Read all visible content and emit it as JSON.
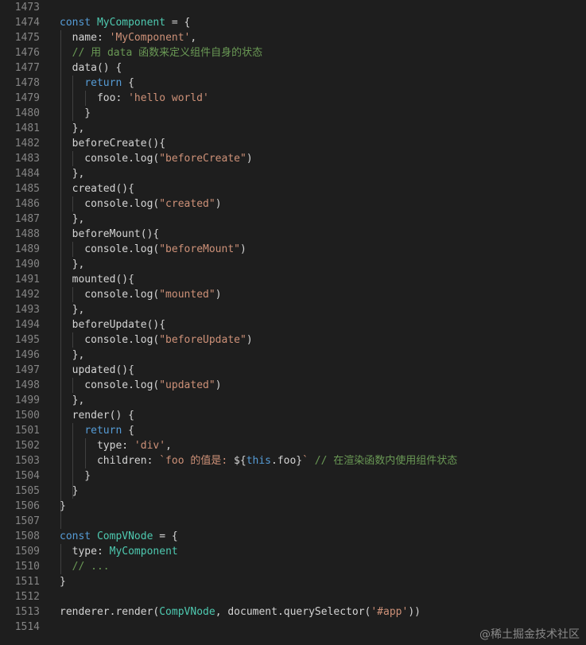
{
  "lines": [
    {
      "num": "1473",
      "segs": []
    },
    {
      "num": "1474",
      "segs": [
        {
          "t": "const ",
          "c": "kw"
        },
        {
          "t": "MyComponent",
          "c": "cls"
        },
        {
          "t": " = {",
          "c": ""
        }
      ]
    },
    {
      "num": "1475",
      "segs": [
        {
          "t": "  name: ",
          "c": ""
        },
        {
          "t": "'MyComponent'",
          "c": "str"
        },
        {
          "t": ",",
          "c": ""
        }
      ]
    },
    {
      "num": "1476",
      "segs": [
        {
          "t": "  // 用 data 函数来定义组件自身的状态",
          "c": "cm"
        }
      ]
    },
    {
      "num": "1477",
      "segs": [
        {
          "t": "  data() {",
          "c": ""
        }
      ]
    },
    {
      "num": "1478",
      "segs": [
        {
          "t": "    ",
          "c": ""
        },
        {
          "t": "return",
          "c": "kw"
        },
        {
          "t": " {",
          "c": ""
        }
      ]
    },
    {
      "num": "1479",
      "segs": [
        {
          "t": "      foo: ",
          "c": ""
        },
        {
          "t": "'hello world'",
          "c": "str"
        }
      ]
    },
    {
      "num": "1480",
      "segs": [
        {
          "t": "    }",
          "c": ""
        }
      ]
    },
    {
      "num": "1481",
      "segs": [
        {
          "t": "  },",
          "c": ""
        }
      ]
    },
    {
      "num": "1482",
      "segs": [
        {
          "t": "  beforeCreate(){",
          "c": ""
        }
      ]
    },
    {
      "num": "1483",
      "segs": [
        {
          "t": "    console.log(",
          "c": ""
        },
        {
          "t": "\"beforeCreate\"",
          "c": "str"
        },
        {
          "t": ")",
          "c": ""
        }
      ]
    },
    {
      "num": "1484",
      "segs": [
        {
          "t": "  },",
          "c": ""
        }
      ]
    },
    {
      "num": "1485",
      "segs": [
        {
          "t": "  created(){",
          "c": ""
        }
      ]
    },
    {
      "num": "1486",
      "segs": [
        {
          "t": "    console.log(",
          "c": ""
        },
        {
          "t": "\"created\"",
          "c": "str"
        },
        {
          "t": ")",
          "c": ""
        }
      ]
    },
    {
      "num": "1487",
      "segs": [
        {
          "t": "  },",
          "c": ""
        }
      ]
    },
    {
      "num": "1488",
      "segs": [
        {
          "t": "  beforeMount(){",
          "c": ""
        }
      ]
    },
    {
      "num": "1489",
      "segs": [
        {
          "t": "    console.log(",
          "c": ""
        },
        {
          "t": "\"beforeMount\"",
          "c": "str"
        },
        {
          "t": ")",
          "c": ""
        }
      ]
    },
    {
      "num": "1490",
      "segs": [
        {
          "t": "  },",
          "c": ""
        }
      ]
    },
    {
      "num": "1491",
      "segs": [
        {
          "t": "  mounted(){",
          "c": ""
        }
      ]
    },
    {
      "num": "1492",
      "segs": [
        {
          "t": "    console.log(",
          "c": ""
        },
        {
          "t": "\"mounted\"",
          "c": "str"
        },
        {
          "t": ")",
          "c": ""
        }
      ]
    },
    {
      "num": "1493",
      "segs": [
        {
          "t": "  },",
          "c": ""
        }
      ]
    },
    {
      "num": "1494",
      "segs": [
        {
          "t": "  beforeUpdate(){",
          "c": ""
        }
      ]
    },
    {
      "num": "1495",
      "segs": [
        {
          "t": "    console.log(",
          "c": ""
        },
        {
          "t": "\"beforeUpdate\"",
          "c": "str"
        },
        {
          "t": ")",
          "c": ""
        }
      ]
    },
    {
      "num": "1496",
      "segs": [
        {
          "t": "  },",
          "c": ""
        }
      ]
    },
    {
      "num": "1497",
      "segs": [
        {
          "t": "  updated(){",
          "c": ""
        }
      ]
    },
    {
      "num": "1498",
      "segs": [
        {
          "t": "    console.log(",
          "c": ""
        },
        {
          "t": "\"updated\"",
          "c": "str"
        },
        {
          "t": ")",
          "c": ""
        }
      ]
    },
    {
      "num": "1499",
      "segs": [
        {
          "t": "  },",
          "c": ""
        }
      ]
    },
    {
      "num": "1500",
      "segs": [
        {
          "t": "  render() {",
          "c": ""
        }
      ]
    },
    {
      "num": "1501",
      "segs": [
        {
          "t": "    ",
          "c": ""
        },
        {
          "t": "return",
          "c": "kw"
        },
        {
          "t": " {",
          "c": ""
        }
      ]
    },
    {
      "num": "1502",
      "segs": [
        {
          "t": "      type: ",
          "c": ""
        },
        {
          "t": "'div'",
          "c": "str"
        },
        {
          "t": ",",
          "c": ""
        }
      ]
    },
    {
      "num": "1503",
      "segs": [
        {
          "t": "      children: ",
          "c": ""
        },
        {
          "t": "`foo 的值是: ",
          "c": "str"
        },
        {
          "t": "${",
          "c": ""
        },
        {
          "t": "this",
          "c": "kw"
        },
        {
          "t": ".foo}",
          "c": ""
        },
        {
          "t": "`",
          "c": "str"
        },
        {
          "t": " ",
          "c": ""
        },
        {
          "t": "// 在渲染函数内使用组件状态",
          "c": "cm"
        }
      ]
    },
    {
      "num": "1504",
      "segs": [
        {
          "t": "    }",
          "c": ""
        }
      ]
    },
    {
      "num": "1505",
      "segs": [
        {
          "t": "  }",
          "c": ""
        }
      ]
    },
    {
      "num": "1506",
      "segs": [
        {
          "t": "}",
          "c": ""
        }
      ]
    },
    {
      "num": "1507",
      "segs": []
    },
    {
      "num": "1508",
      "segs": [
        {
          "t": "const ",
          "c": "kw"
        },
        {
          "t": "CompVNode",
          "c": "cls"
        },
        {
          "t": " = {",
          "c": ""
        }
      ]
    },
    {
      "num": "1509",
      "segs": [
        {
          "t": "  type: ",
          "c": ""
        },
        {
          "t": "MyComponent",
          "c": "cls"
        }
      ]
    },
    {
      "num": "1510",
      "segs": [
        {
          "t": "  // ...",
          "c": "cm"
        }
      ]
    },
    {
      "num": "1511",
      "segs": [
        {
          "t": "}",
          "c": ""
        }
      ]
    },
    {
      "num": "1512",
      "segs": []
    },
    {
      "num": "1513",
      "segs": [
        {
          "t": "renderer.render(",
          "c": ""
        },
        {
          "t": "CompVNode",
          "c": "cls"
        },
        {
          "t": ", document.querySelector(",
          "c": ""
        },
        {
          "t": "'#app'",
          "c": "str"
        },
        {
          "t": "))",
          "c": ""
        }
      ]
    },
    {
      "num": "1514",
      "segs": []
    }
  ],
  "watermark": "@稀土掘金技术社区"
}
